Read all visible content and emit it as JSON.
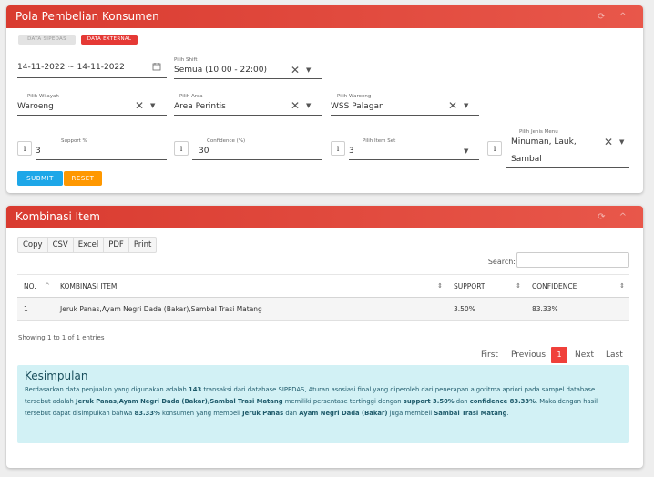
{
  "card1": {
    "title": "Pola Pembelian Konsumen",
    "header_icons": "⟳ ^",
    "badges": {
      "sipedas": "DATA SIPEDAS",
      "external": "DATA EXTERNAL"
    },
    "date_range": {
      "value": "14-11-2022 ~ 14-11-2022",
      "icon": "calendar-icon"
    },
    "shift": {
      "label": "Pilih Shift",
      "value": "Semua (10:00 - 22:00)"
    },
    "wilayah": {
      "label": "Pilih Wilayah",
      "value": "Waroeng"
    },
    "area": {
      "label": "Pilih Area",
      "value": "Area Perintis"
    },
    "waroeng": {
      "label": "Pilih Waroeng",
      "value": "WSS Palagan"
    },
    "support": {
      "label": "Support %",
      "value": "3"
    },
    "confidence": {
      "label": "Confidence (%)",
      "value": "30"
    },
    "item_set": {
      "label": "Pilih Item Set",
      "value": "3"
    },
    "jenis_menu": {
      "label": "Pilih Jenis Menu",
      "value_line1": "Minuman, Lauk,",
      "value_line2": "Sambal"
    },
    "info_glyph": "i",
    "clear_glyph": "✕",
    "caret_glyph": "▼",
    "submit_label": "SUBMIT",
    "reset_label": "RESET"
  },
  "card2": {
    "title": "Kombinasi Item",
    "header_icons": "⟳ ^",
    "export_buttons": [
      "Copy",
      "CSV",
      "Excel",
      "PDF",
      "Print"
    ],
    "search_label": "Search:",
    "table": {
      "headers": [
        "NO.",
        "KOMBINASI ITEM",
        "SUPPORT",
        "CONFIDENCE"
      ],
      "rows": [
        [
          "1",
          "Jeruk Panas,Ayam Negri Dada (Bakar),Sambal Trasi Matang",
          "3.50%",
          "83.33%"
        ]
      ]
    },
    "showing": "Showing 1 to 1 of 1 entries",
    "pagination": {
      "first": "First",
      "previous": "Previous",
      "current": "1",
      "next": "Next",
      "last": "Last"
    },
    "conclusion": {
      "title": "Kesimpulan",
      "t1": "Berdasarkan data penjualan yang digunakan adalah ",
      "b1": "143",
      "t2": " transaksi dari database SIPEDAS, Aturan asosiasi final yang diperoleh dari penerapan algoritma apriori pada sampel database tersebut adalah ",
      "b2": "Jeruk Panas,Ayam Negri Dada (Bakar),Sambal Trasi Matang",
      "t3": " memiliki persentase tertinggi dengan ",
      "b3": "support 3.50%",
      "t4": " dan ",
      "b4": "confidence 83.33%",
      "t5": ". Maka dengan hasil tersebut dapat disimpulkan bahwa ",
      "b5": "83.33%",
      "t6": " konsumen yang membeli ",
      "b6": "Jeruk Panas",
      "t7": " dan ",
      "b7": "Ayam Negri Dada (Bakar)",
      "t8": " juga membeli ",
      "b8": "Sambal Trasi Matang",
      "t9": "."
    }
  }
}
